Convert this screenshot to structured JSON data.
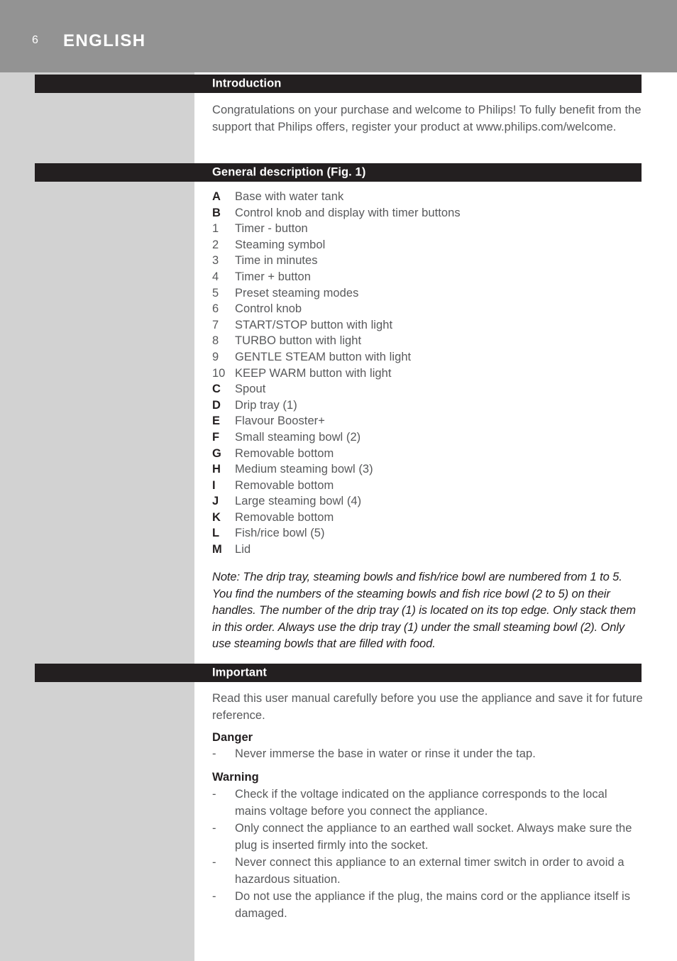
{
  "page": {
    "folio": "6",
    "chapter_title": "ENGLISH",
    "colors": {
      "top_band": "#939393",
      "sidebar": "#d2d2d2",
      "section_bar": "#231f20",
      "body_text": "#58595b",
      "heading_text": "#231f20",
      "bar_text": "#ffffff"
    }
  },
  "sections": {
    "introduction": {
      "title": "Introduction",
      "paragraph": "Congratulations on your purchase and welcome to Philips! To fully benefit from the support that Philips offers, register your product at www.philips.com/welcome."
    },
    "general_description": {
      "title": "General description (Fig. 1)",
      "items": [
        {
          "key": "A",
          "type": "alpha",
          "label": "Base with water tank"
        },
        {
          "key": "B",
          "type": "alpha",
          "label": "Control knob and display with timer buttons"
        },
        {
          "key": "1",
          "type": "num",
          "label": "Timer - button"
        },
        {
          "key": "2",
          "type": "num",
          "label": "Steaming symbol"
        },
        {
          "key": "3",
          "type": "num",
          "label": "Time in minutes"
        },
        {
          "key": "4",
          "type": "num",
          "label": "Timer + button"
        },
        {
          "key": "5",
          "type": "num",
          "label": "Preset steaming modes"
        },
        {
          "key": "6",
          "type": "num",
          "label": "Control knob"
        },
        {
          "key": "7",
          "type": "num",
          "label": "START/STOP button with light"
        },
        {
          "key": "8",
          "type": "num",
          "label": "TURBO button with light"
        },
        {
          "key": "9",
          "type": "num",
          "label": "GENTLE STEAM button with light"
        },
        {
          "key": "10",
          "type": "num",
          "label": "KEEP WARM button with light"
        },
        {
          "key": "C",
          "type": "alpha",
          "label": "Spout"
        },
        {
          "key": "D",
          "type": "alpha",
          "label": "Drip tray (1)"
        },
        {
          "key": "E",
          "type": "alpha",
          "label": "Flavour Booster+"
        },
        {
          "key": "F",
          "type": "alpha",
          "label": "Small steaming bowl (2)"
        },
        {
          "key": "G",
          "type": "alpha",
          "label": "Removable bottom"
        },
        {
          "key": "H",
          "type": "alpha",
          "label": "Medium steaming bowl (3)"
        },
        {
          "key": "I",
          "type": "alpha",
          "label": "Removable bottom"
        },
        {
          "key": "J",
          "type": "alpha",
          "label": "Large steaming bowl (4)"
        },
        {
          "key": "K",
          "type": "alpha",
          "label": "Removable bottom"
        },
        {
          "key": "L",
          "type": "alpha",
          "label": "Fish/rice bowl (5)"
        },
        {
          "key": "M",
          "type": "alpha",
          "label": "Lid"
        }
      ],
      "note": "Note: The drip tray, steaming bowls and fish/rice bowl are numbered from 1 to 5. You find the numbers of the steaming bowls and fish rice bowl (2 to 5) on their handles. The number of the drip tray (1) is located on its top edge. Only stack them in this order. Always use the drip tray (1) under the small steaming bowl (2). Only use steaming bowls that are filled with food."
    },
    "important": {
      "title": "Important",
      "paragraph": "Read this user manual carefully before you use the appliance and save it for future reference.",
      "danger": {
        "heading": "Danger",
        "bullet_marker": "-",
        "items": [
          "Never immerse the base in water or rinse it under the tap."
        ]
      },
      "warning": {
        "heading": "Warning",
        "bullet_marker": "-",
        "items": [
          "Check if the voltage indicated on the appliance corresponds to the local mains voltage before you connect the appliance.",
          "Only connect the appliance to an earthed wall socket. Always make sure the plug is inserted firmly into the socket.",
          "Never connect this appliance to an external timer switch in order to avoid a hazardous situation.",
          "Do not use the appliance if the plug, the mains cord or the appliance itself is damaged."
        ]
      }
    }
  }
}
